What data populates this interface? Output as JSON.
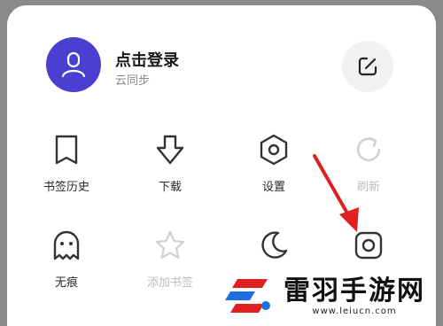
{
  "account": {
    "title": "点击登录",
    "subtitle": "云同步"
  },
  "grid": {
    "items": [
      {
        "label": "书签历史",
        "icon": "bookmark-icon",
        "enabled": true
      },
      {
        "label": "下载",
        "icon": "download-icon",
        "enabled": true
      },
      {
        "label": "设置",
        "icon": "settings-hexagon-icon",
        "enabled": true
      },
      {
        "label": "刷新",
        "icon": "refresh-icon",
        "enabled": false
      },
      {
        "label": "无痕",
        "icon": "ghost-icon",
        "enabled": true
      },
      {
        "label": "添加书签",
        "icon": "star-icon",
        "enabled": false
      },
      {
        "label": "",
        "icon": "moon-icon",
        "enabled": true
      },
      {
        "label": "",
        "icon": "user-frame-icon",
        "enabled": true
      }
    ]
  },
  "watermark": {
    "name": "雷羽手游网",
    "url": "www.leiucn.com"
  },
  "colors": {
    "accent": "#4a3fd0",
    "arrow": "#e02020",
    "text": "#2a2a2a",
    "disabled": "#bdbdbd"
  }
}
